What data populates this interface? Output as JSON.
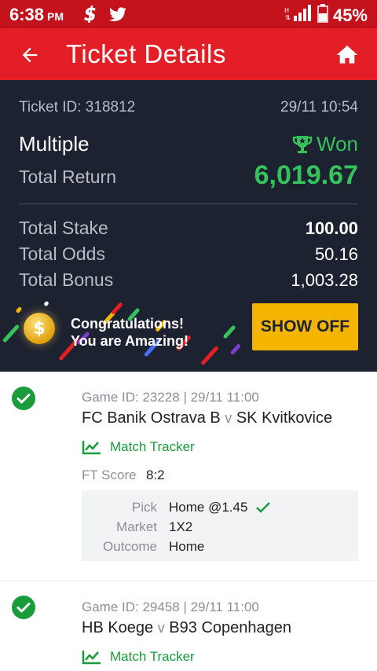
{
  "status_bar": {
    "time": "6:38",
    "ampm": "PM",
    "battery": "45%",
    "icons": [
      "dollar-icon",
      "twitter-icon",
      "signal-icon",
      "battery-icon"
    ]
  },
  "toolbar": {
    "title": "Ticket Details",
    "back_icon": "arrow-left-icon",
    "home_icon": "home-icon"
  },
  "ticket": {
    "id_text": "Ticket ID: 318812",
    "date": "29/11 10:54",
    "bet_type": "Multiple",
    "status": "Won",
    "total_return_label": "Total Return",
    "total_return": "6,019.67",
    "rows": [
      {
        "label": "Total Stake",
        "value": "100.00"
      },
      {
        "label": "Total Odds",
        "value": "50.16"
      },
      {
        "label": "Total Bonus",
        "value": "1,003.28"
      }
    ]
  },
  "banner": {
    "line1": "Congratulations!",
    "line2": "You are Amazing!",
    "coin_symbol": "$",
    "show_off_label": "SHOW OFF"
  },
  "games": [
    {
      "meta": "Game ID: 23228 | 29/11 11:00",
      "home": "FC Banik Ostrava B",
      "vs": "v",
      "away": "SK Kvitkovice",
      "tracker_label": "Match Tracker",
      "ft_label": "FT Score",
      "ft_score": "8:2",
      "pick_label": "Pick",
      "pick": "Home @1.45",
      "market_label": "Market",
      "market": "1X2",
      "outcome_label": "Outcome",
      "outcome": "Home"
    },
    {
      "meta": "Game ID: 29458 | 29/11 11:00",
      "home": "HB Koege",
      "vs": "v",
      "away": "B93 Copenhagen",
      "tracker_label": "Match Tracker"
    }
  ],
  "colors": {
    "status_bar": "#c4121d",
    "toolbar": "#e41e26",
    "panel": "#1c2230",
    "win_green": "#35c25c",
    "accent_yellow": "#f5b400",
    "tracker_green": "#1a9b3c"
  }
}
